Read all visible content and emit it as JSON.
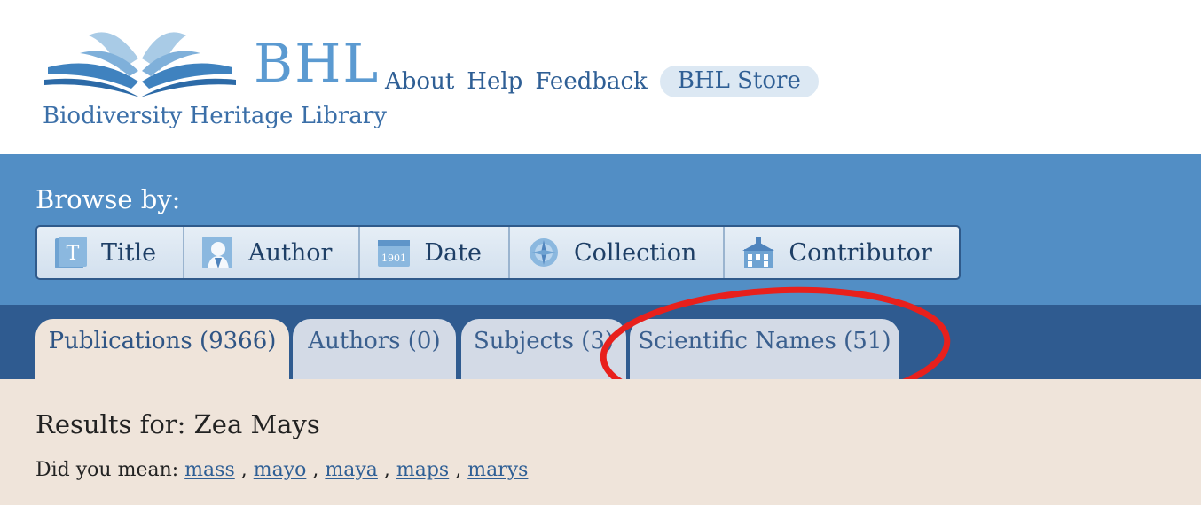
{
  "header": {
    "logo": {
      "abbrev": "BHL",
      "tagline": "Biodiversity Heritage Library"
    },
    "nav": [
      {
        "label": "About"
      },
      {
        "label": "Help"
      },
      {
        "label": "Feedback"
      },
      {
        "label": "BHL Store"
      }
    ]
  },
  "browse": {
    "label": "Browse by:",
    "buttons": [
      {
        "label": "Title",
        "icon": "title-t-icon"
      },
      {
        "label": "Author",
        "icon": "author-silhouette-icon"
      },
      {
        "label": "Date",
        "icon": "date-1901-icon"
      },
      {
        "label": "Collection",
        "icon": "collection-compass-icon"
      },
      {
        "label": "Contributor",
        "icon": "contributor-building-icon"
      }
    ]
  },
  "tabs": [
    {
      "label": "Publications (9366)",
      "active": true
    },
    {
      "label": "Authors (0)",
      "active": false
    },
    {
      "label": "Subjects (3)",
      "active": false
    },
    {
      "label": "Scientific Names (51)",
      "active": false
    }
  ],
  "results": {
    "title": "Results for: Zea Mays",
    "did_you_mean_label": "Did you mean:",
    "suggestions": [
      "mass",
      "mayo",
      "maya",
      "maps",
      "marys"
    ]
  },
  "colors": {
    "brand_blue": "#528ec5",
    "tab_bar": "#2f5b90",
    "content_bg": "#efe4da",
    "annotation_red": "#e8201c"
  }
}
